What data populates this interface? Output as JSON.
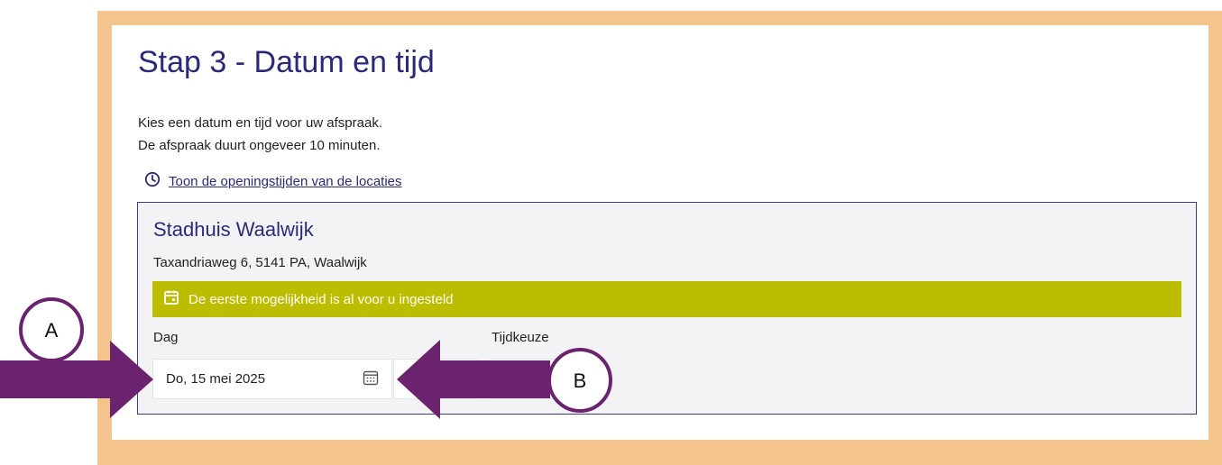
{
  "header": {
    "title": "Stap 3 - Datum en tijd",
    "intro_line1": "Kies een datum en tijd voor uw afspraak.",
    "intro_line2": "De afspraak duurt ongeveer 10 minuten.",
    "hours_link": "Toon de openingstijden van de locaties"
  },
  "location": {
    "name": "Stadhuis Waalwijk",
    "address": "Taxandriaweg 6, 5141 PA, Waalwijk",
    "notice": "De eerste mogelijkheid is al voor u ingesteld"
  },
  "form": {
    "day_label": "Dag",
    "day_value": "Do, 15 mei 2025",
    "time_label": "Tijdkeuze"
  },
  "annotations": {
    "callout_a": "A",
    "callout_b": "B"
  },
  "icons": {
    "hours": "clock-icon",
    "notice": "calendar-icon",
    "date_picker": "calendar-grid-icon"
  },
  "colors": {
    "title": "#2b2a7a",
    "frame": "#f4c48f",
    "notice_bg": "#bdbd00",
    "arrow": "#6b2370"
  }
}
